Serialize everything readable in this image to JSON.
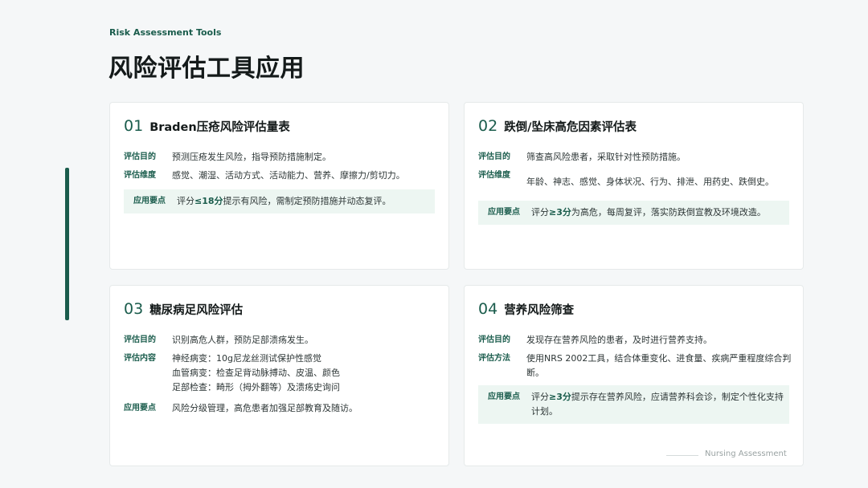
{
  "header": {
    "eyebrow": "Risk Assessment Tools",
    "title": "风险评估工具应用"
  },
  "cards": [
    {
      "num": "01",
      "title": "Braden压疮风险评估量表",
      "rows": [
        {
          "label": "评估目的",
          "value": "预测压疮发生风险，指导预防措施制定。"
        },
        {
          "label": "评估维度",
          "value": "感觉、潮湿、活动方式、活动能力、营养、摩擦力/剪切力。"
        }
      ],
      "highlight": {
        "label": "应用要点",
        "pre": "评分",
        "em": "≤18分",
        "post": "提示有风险，需制定预防措施并动态复评。"
      }
    },
    {
      "num": "02",
      "title": "跌倒/坠床高危因素评估表",
      "rows": [
        {
          "label": "评估目的",
          "value": "筛查高风险患者，采取针对性预防措施。"
        },
        {
          "label": "评估维度",
          "value": "年龄、神志、感觉、身体状况、行为、排泄、用药史、跌倒史。"
        }
      ],
      "highlight": {
        "label": "应用要点",
        "pre": "评分",
        "em": "≥3分",
        "post": "为高危，每周复评，落实防跌倒宣教及环境改造。"
      }
    },
    {
      "num": "03",
      "title": "糖尿病足风险评估",
      "rows": [
        {
          "label": "评估目的",
          "value": "识别高危人群，预防足部溃疡发生。"
        },
        {
          "label": "评估内容",
          "lines": [
            "神经病变：10g尼龙丝测试保护性感觉",
            "血管病变：检查足背动脉搏动、皮温、颜色",
            "足部检查：畸形（拇外翻等）及溃疡史询问"
          ]
        },
        {
          "label": "应用要点",
          "value": "风险分级管理，高危患者加强足部教育及随访。"
        }
      ]
    },
    {
      "num": "04",
      "title": "营养风险筛查",
      "rows": [
        {
          "label": "评估目的",
          "value": "发现存在营养风险的患者，及时进行营养支持。"
        },
        {
          "label": "评估方法",
          "value": "使用NRS 2002工具，结合体重变化、进食量、疾病严重程度综合判断。"
        }
      ],
      "highlight": {
        "label": "应用要点",
        "pre": "评分",
        "em": "≥3分",
        "post": "提示存在营养风险，应请营养科会诊，制定个性化支持计划。"
      }
    }
  ],
  "footer": {
    "text": "Nursing Assessment"
  },
  "colors": {
    "accent": "#1a5c4c",
    "highlight_bg": "#edf6f2"
  }
}
